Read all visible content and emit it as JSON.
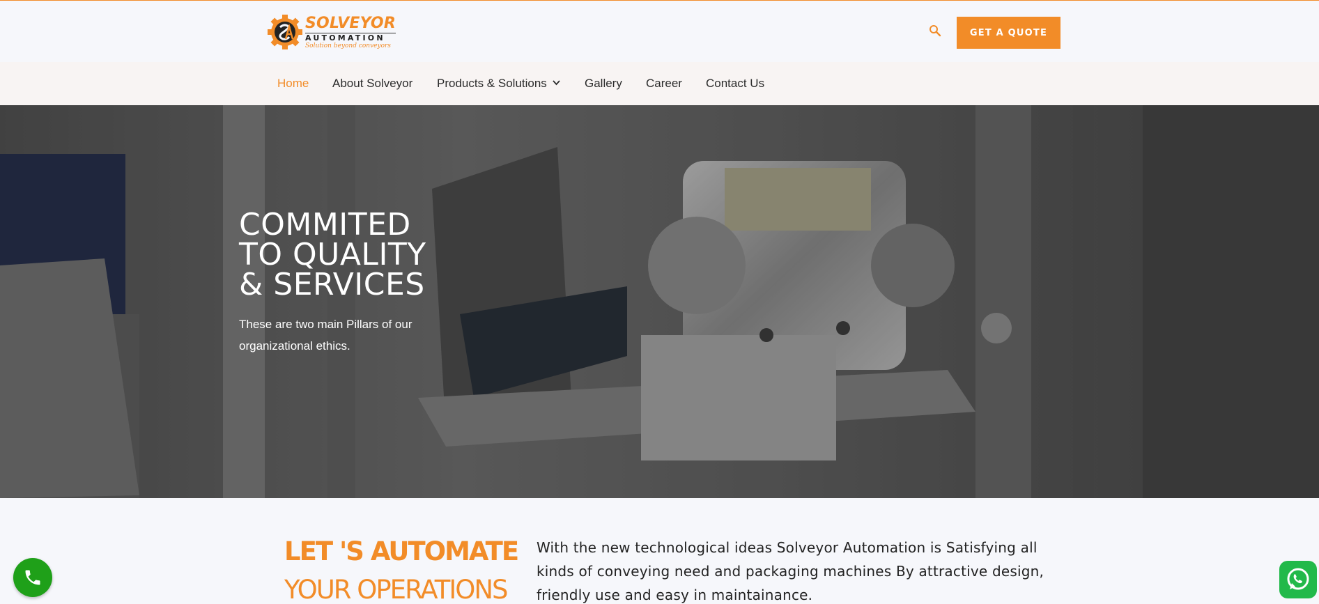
{
  "brand": {
    "name": "SOLVEYOR",
    "sub": "AUTOMATION",
    "tagline": "Solution beyond conveyors",
    "accent": "#f28c28"
  },
  "header": {
    "search_icon": "search-icon",
    "quote_label": "GET A QUOTE"
  },
  "nav": {
    "items": [
      {
        "label": "Home",
        "active": true
      },
      {
        "label": "About Solveyor"
      },
      {
        "label": "Products & Solutions",
        "has_dropdown": true
      },
      {
        "label": "Gallery"
      },
      {
        "label": "Career"
      },
      {
        "label": "Contact Us"
      }
    ]
  },
  "hero": {
    "title_lines": [
      "COMMITED",
      "TO QUALITY",
      "& SERVICES"
    ],
    "subtitle": "These are two main Pillars of our organizational ethics."
  },
  "intro": {
    "heading_line1": "LET 'S AUTOMATE",
    "heading_line2": "YOUR OPERATIONS",
    "text": "With the new technological ideas Solveyor Automation is Satisfying all kinds of conveying need and packaging machines By attractive design, friendly use and easy in maintainance."
  },
  "floating": {
    "call_icon": "phone-icon",
    "chat_icon": "whatsapp-icon"
  }
}
